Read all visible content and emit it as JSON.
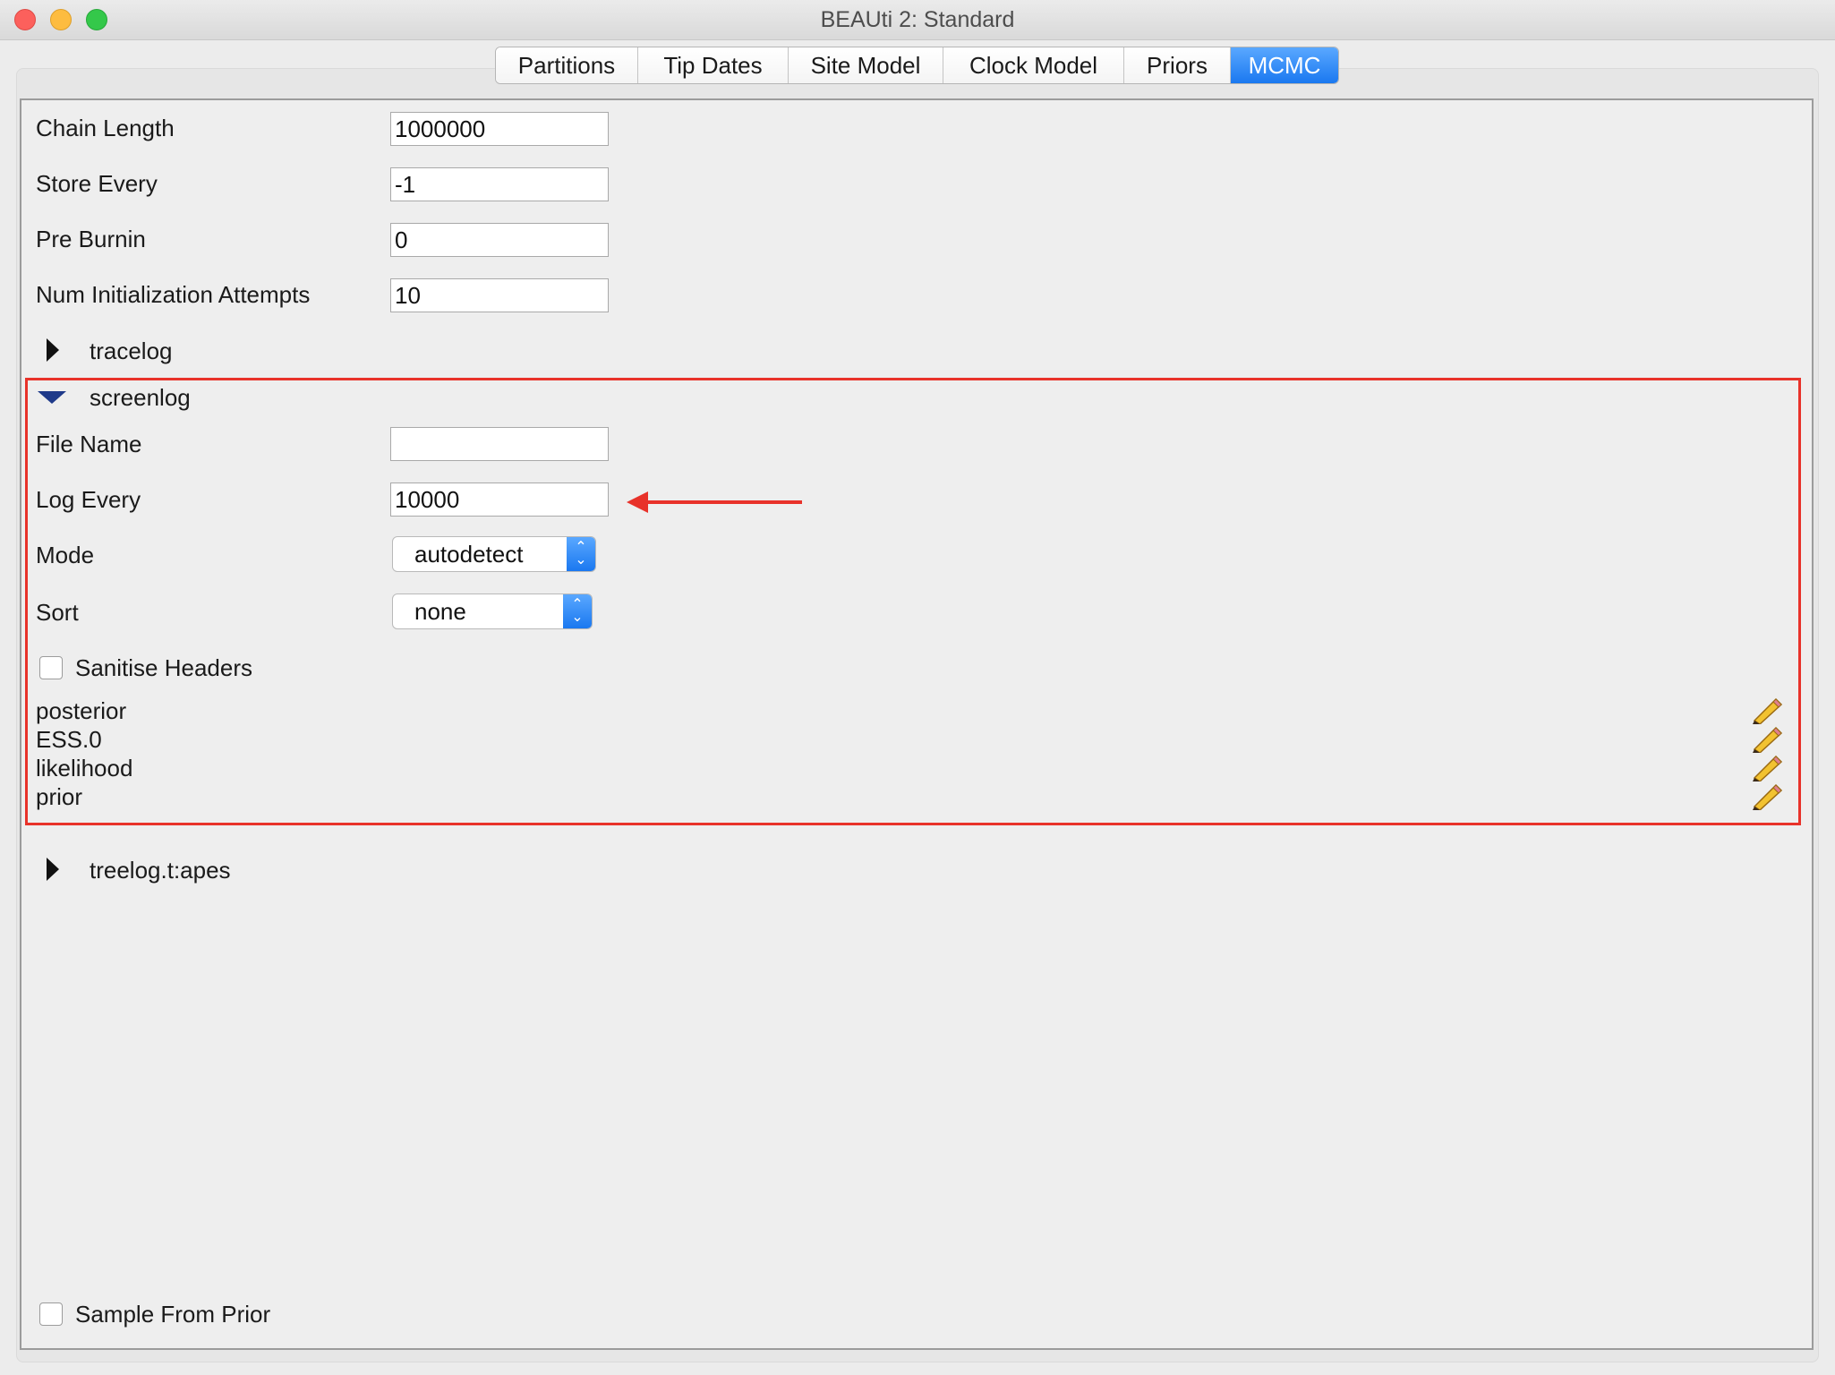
{
  "window": {
    "title": "BEAUti 2: Standard"
  },
  "tabs": [
    {
      "label": "Partitions",
      "active": false
    },
    {
      "label": "Tip Dates",
      "active": false
    },
    {
      "label": "Site Model",
      "active": false
    },
    {
      "label": "Clock Model",
      "active": false
    },
    {
      "label": "Priors",
      "active": false
    },
    {
      "label": "MCMC",
      "active": true
    }
  ],
  "mcmc": {
    "chain_length": {
      "label": "Chain Length",
      "value": "1000000"
    },
    "store_every": {
      "label": "Store Every",
      "value": "-1"
    },
    "pre_burnin": {
      "label": "Pre Burnin",
      "value": "0"
    },
    "num_init_attempts": {
      "label": "Num Initialization Attempts",
      "value": "10"
    }
  },
  "tracelog": {
    "label": "tracelog"
  },
  "screenlog": {
    "label": "screenlog",
    "file_name": {
      "label": "File Name",
      "value": ""
    },
    "log_every": {
      "label": "Log Every",
      "value": "10000"
    },
    "mode": {
      "label": "Mode",
      "value": "autodetect"
    },
    "sort": {
      "label": "Sort",
      "value": "none"
    },
    "sanitise_headers": {
      "label": "Sanitise Headers",
      "checked": false
    },
    "loggers": [
      "posterior",
      "ESS.0",
      "likelihood",
      "prior"
    ]
  },
  "treelog": {
    "label": "treelog.t:apes"
  },
  "sample_from_prior": {
    "label": "Sample From Prior",
    "checked": false
  },
  "colors": {
    "accent": "#1a78f0",
    "highlight": "#e8322a"
  }
}
